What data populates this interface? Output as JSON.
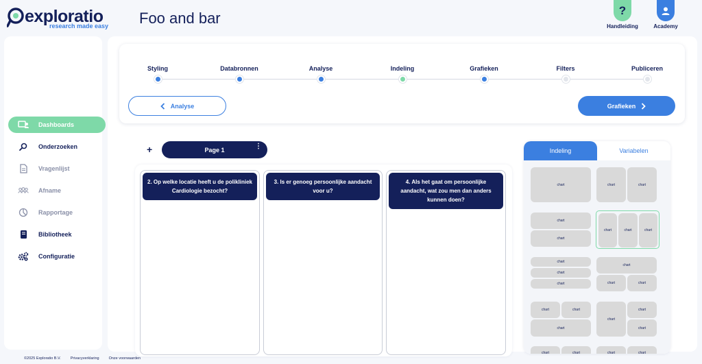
{
  "brand": {
    "name": "exploratio",
    "tagline": "research made easy"
  },
  "page_title": "Foo and bar",
  "header": {
    "help_label": "Handleiding",
    "help_glyph": "?",
    "academy_label": "Academy"
  },
  "sidebar": {
    "items": [
      {
        "label": "Dashboards",
        "icon": "dashboard-icon",
        "state": "active"
      },
      {
        "label": "Onderzoeken",
        "icon": "search-icon",
        "state": "dark"
      },
      {
        "label": "Vragenlijst",
        "icon": "document-icon",
        "state": "muted"
      },
      {
        "label": "Afname",
        "icon": "users-icon",
        "state": "muted"
      },
      {
        "label": "Rapportage",
        "icon": "pie-chart-icon",
        "state": "muted"
      },
      {
        "label": "Bibliotheek",
        "icon": "book-icon",
        "state": "dark"
      },
      {
        "label": "Configuratie",
        "icon": "gears-icon",
        "state": "dark"
      }
    ]
  },
  "footer": {
    "copyright": "©2025 Exploratio B.V.",
    "privacy": "Privacyverklaring",
    "terms": "Onze voorwaarden"
  },
  "stepper": {
    "steps": [
      {
        "label": "Styling",
        "status": "done"
      },
      {
        "label": "Databronnen",
        "status": "done"
      },
      {
        "label": "Analyse",
        "status": "done"
      },
      {
        "label": "Indeling",
        "status": "done-green"
      },
      {
        "label": "Grafieken",
        "status": "current"
      },
      {
        "label": "Filters",
        "status": "todo"
      },
      {
        "label": "Publiceren",
        "status": "todo"
      }
    ],
    "back_label": "Analyse",
    "next_label": "Grafieken"
  },
  "pages": {
    "add_glyph": "+",
    "active_tab": "Page 1",
    "menu_glyph": "⋮"
  },
  "questions": [
    "2. Op welke locatie heeft u de polikliniek Cardiologie bezocht?",
    "3. Is er genoeg persoonlijke aandacht voor u?",
    "4. Als het gaat om persoonlijke aandacht, wat zou men dan anders kunnen doen?"
  ],
  "panel": {
    "tab_layout": "Indeling",
    "tab_variables": "Variabelen",
    "block_label": "chart"
  },
  "colors": {
    "navy": "#14205a",
    "blue": "#3b7fe0",
    "green": "#7ed9a8",
    "block": "#d9d9d9"
  }
}
